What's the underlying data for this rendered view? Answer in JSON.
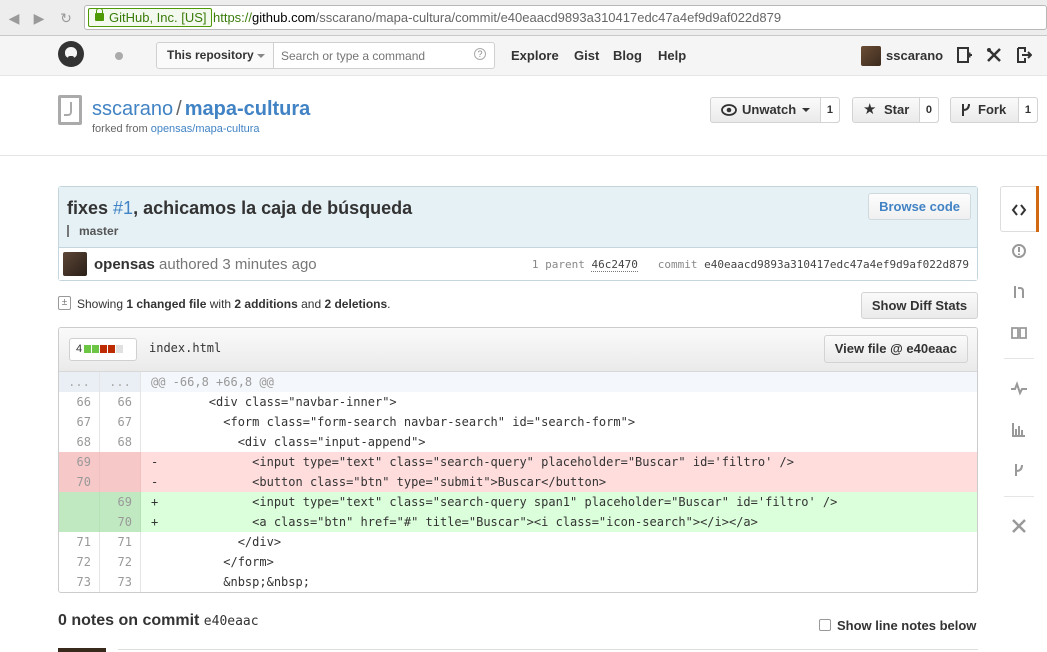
{
  "browser": {
    "back_icon": "arrow-left-icon",
    "forward_icon": "arrow-right-icon",
    "reload_icon": "reload-icon",
    "ssl_label": "GitHub, Inc. [US]",
    "url_scheme": "https://",
    "url_host": "github.com",
    "url_path": "/sscarano/mapa-cultura/commit/e40eaacd9893a310417edc47a4ef9d9af022d879"
  },
  "header": {
    "scope_label": "This repository",
    "search_placeholder": "Search or type a command",
    "search_help": "?",
    "nav": [
      "Explore",
      "Gist",
      "Blog",
      "Help"
    ],
    "username": "sscarano"
  },
  "repo": {
    "owner": "sscarano",
    "separator": "/",
    "name": "mapa-cultura",
    "forked_from_prefix": "forked from",
    "forked_from_link": "opensas/mapa-cultura",
    "unwatch_label": "Unwatch",
    "unwatch_count": "1",
    "star_label": "Star",
    "star_count": "0",
    "fork_label": "Fork",
    "fork_count": "1"
  },
  "commit": {
    "title_prefix": "fixes ",
    "issue_ref": "#1",
    "title_suffix": ", achicamos la caja de búsqueda",
    "branch": "master",
    "browse_code": "Browse code",
    "author": "opensas",
    "authored_text": " authored 3 minutes ago",
    "parent_label": "1 parent",
    "parent_sha": "46c2470",
    "commit_label": "commit",
    "commit_sha": "e40eaacd9893a310417edc47a4ef9d9af022d879"
  },
  "toc": {
    "showing": "Showing ",
    "changed": "1 changed file",
    "with": " with ",
    "additions": "2 additions",
    "and": " and ",
    "deletions": "2 deletions",
    "period": ".",
    "diff_stats_button": "Show Diff Stats"
  },
  "file": {
    "changes": "4",
    "stat_blocks": [
      "add",
      "add",
      "del",
      "del",
      "neutral"
    ],
    "colors": {
      "add": "#6cc644",
      "del": "#bd2c00",
      "neutral": "#e0e0e0"
    },
    "name": "index.html",
    "view_button": "View file @ e40eaac",
    "lines": [
      {
        "type": "hunk",
        "old": "...",
        "new": "...",
        "code": "@@ -66,8 +66,8 @@"
      },
      {
        "type": "ctx",
        "old": "66",
        "new": "66",
        "code": "        <div class=\"navbar-inner\">"
      },
      {
        "type": "ctx",
        "old": "67",
        "new": "67",
        "code": "          <form class=\"form-search navbar-search\" id=\"search-form\">"
      },
      {
        "type": "ctx",
        "old": "68",
        "new": "68",
        "code": "            <div class=\"input-append\">"
      },
      {
        "type": "del",
        "old": "69",
        "new": "",
        "code": "-             <input type=\"text\" class=\"search-query\" placeholder=\"Buscar\" id='filtro' />"
      },
      {
        "type": "del",
        "old": "70",
        "new": "",
        "code": "-             <button class=\"btn\" type=\"submit\">Buscar</button>"
      },
      {
        "type": "add",
        "old": "",
        "new": "69",
        "code": "+             <input type=\"text\" class=\"search-query span1\" placeholder=\"Buscar\" id='filtro' />"
      },
      {
        "type": "add",
        "old": "",
        "new": "70",
        "code": "+             <a class=\"btn\" href=\"#\" title=\"Buscar\"><i class=\"icon-search\"></i></a>"
      },
      {
        "type": "ctx",
        "old": "71",
        "new": "71",
        "code": "            </div>"
      },
      {
        "type": "ctx",
        "old": "72",
        "new": "72",
        "code": "          </form>"
      },
      {
        "type": "ctx",
        "old": "73",
        "new": "73",
        "code": "          &nbsp;&nbsp;"
      }
    ]
  },
  "notes": {
    "title": "0 notes on commit ",
    "sha": "e40eaac",
    "show_line_notes": "Show line notes below"
  },
  "sidebar": {
    "items": [
      "code-icon",
      "issues-icon",
      "pull-requests-icon",
      "wiki-icon",
      "pulse-icon",
      "graphs-icon",
      "network-icon",
      "settings-icon"
    ]
  }
}
